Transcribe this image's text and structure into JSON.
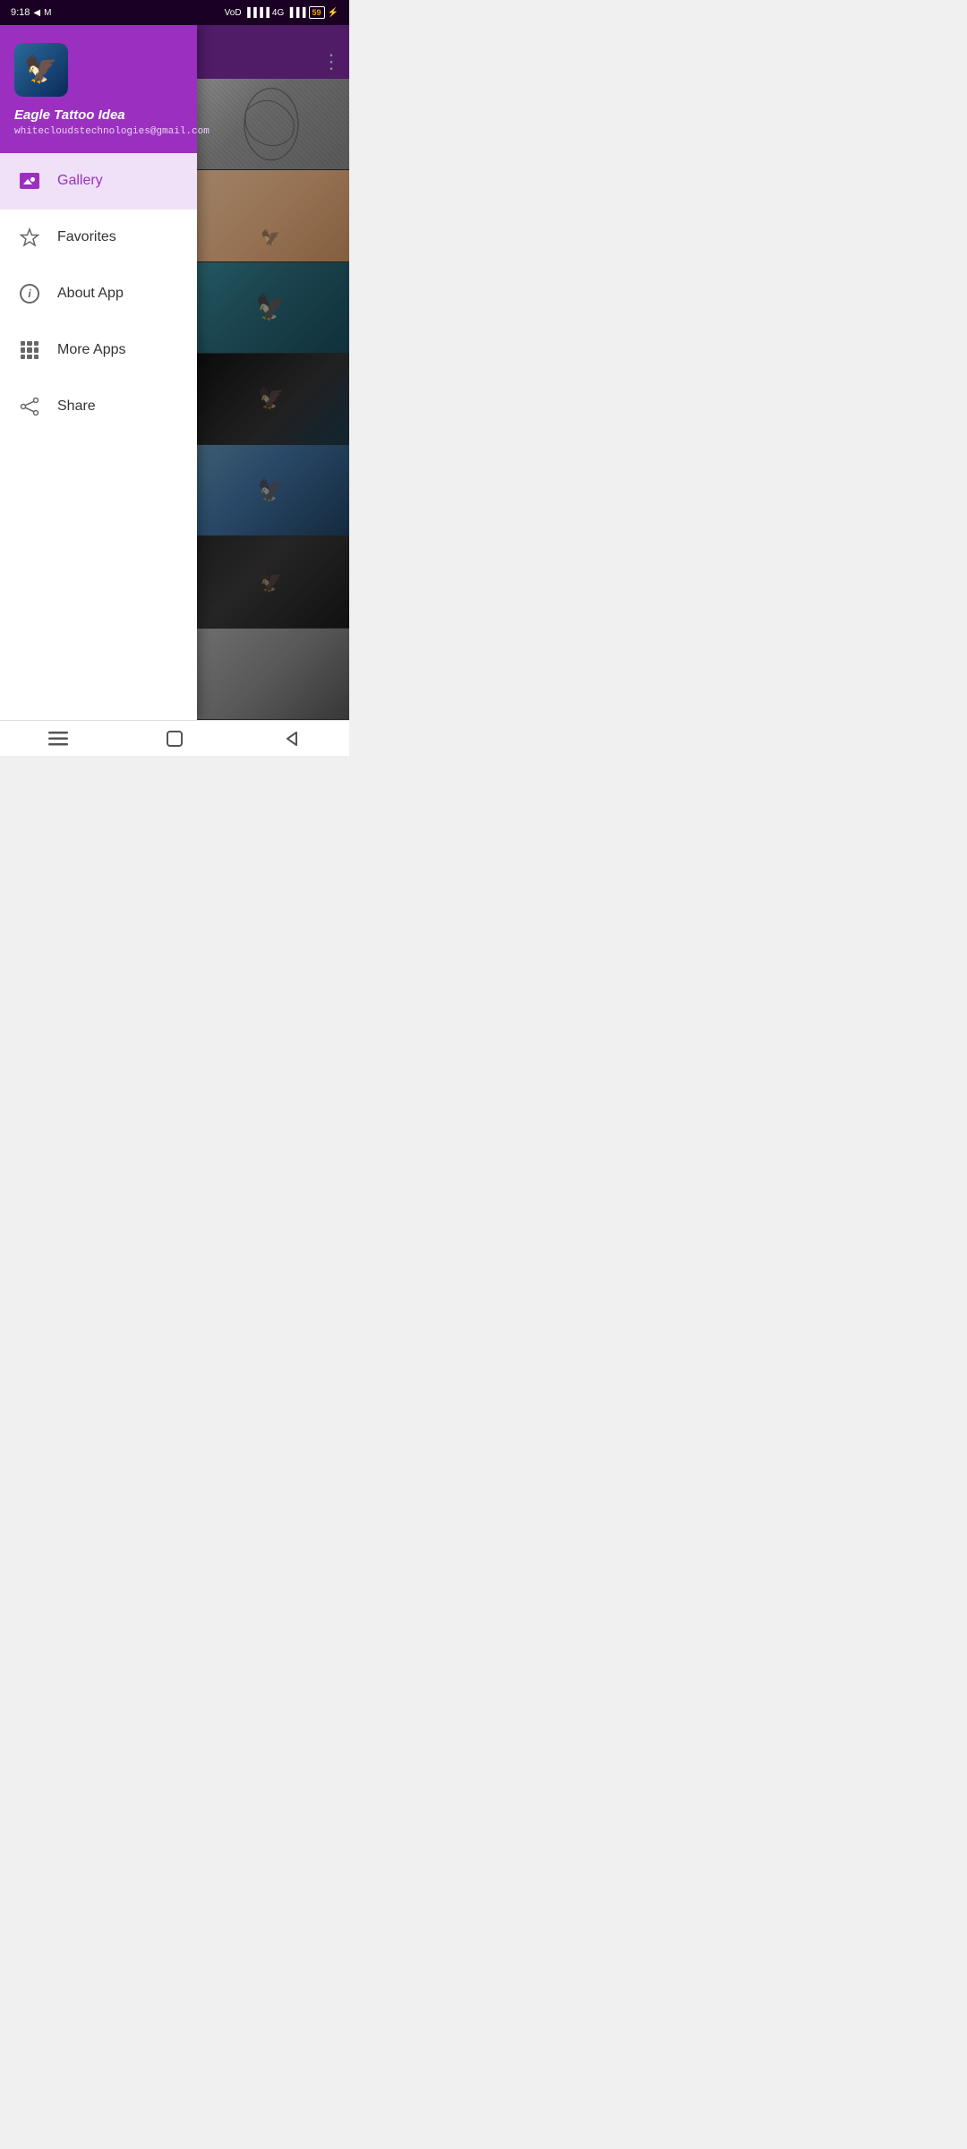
{
  "statusBar": {
    "time": "9:18",
    "battery": "59",
    "batteryIcon": "⚡"
  },
  "header": {
    "appName": "Eagle Tattoo Idea",
    "email": "whitecloudstechnologies@gmail.com",
    "threeDotsLabel": "⋮"
  },
  "nav": {
    "items": [
      {
        "id": "gallery",
        "label": "Gallery",
        "active": true
      },
      {
        "id": "favorites",
        "label": "Favorites",
        "active": false
      },
      {
        "id": "about",
        "label": "About App",
        "active": false
      },
      {
        "id": "more",
        "label": "More Apps",
        "active": false
      },
      {
        "id": "share",
        "label": "Share",
        "active": false
      }
    ]
  },
  "bottomNav": {
    "menuLabel": "☰",
    "homeLabel": "⬜",
    "backLabel": "◁"
  }
}
